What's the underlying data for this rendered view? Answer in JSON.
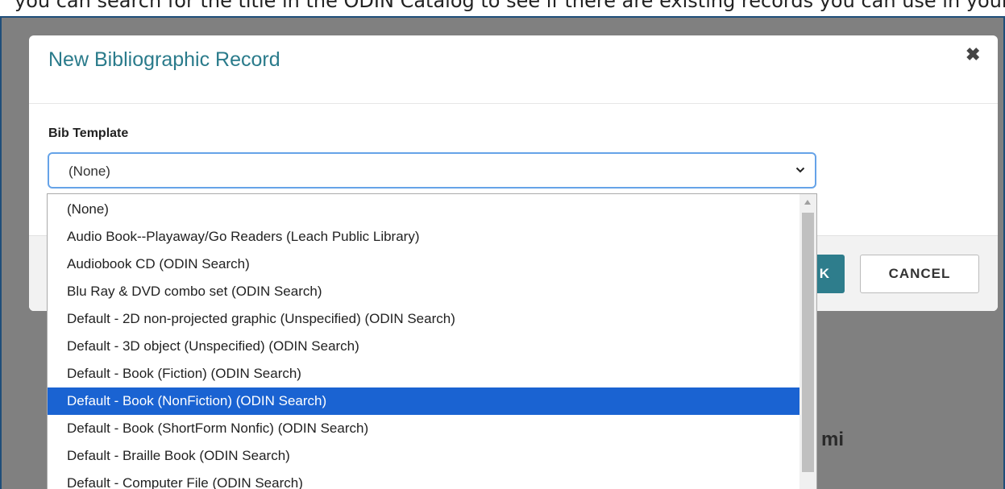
{
  "top_text": "you can search for the title in the ODIN Catalog to see if there are existing records you can use in your catalog.",
  "background_text": "mi",
  "modal": {
    "title": "New Bibliographic Record",
    "close_icon": "close-icon",
    "field_label": "Bib Template",
    "selected_value": "(None)",
    "ok_label": "K",
    "cancel_label": "CANCEL"
  },
  "dropdown": {
    "options": [
      "(None)",
      "Audio Book--Playaway/Go Readers (Leach Public Library)",
      "Audiobook CD (ODIN Search)",
      "Blu Ray & DVD combo set (ODIN Search)",
      "Default - 2D non-projected graphic (Unspecified) (ODIN Search)",
      "Default - 3D object (Unspecified) (ODIN Search)",
      "Default - Book (Fiction) (ODIN Search)",
      "Default - Book (NonFiction) (ODIN Search)",
      "Default - Book (ShortForm Nonfic) (ODIN Search)",
      "Default - Braille Book (ODIN Search)",
      "Default - Computer File (ODIN Search)"
    ],
    "highlighted": "Default - Book (NonFiction) (ODIN Search)"
  },
  "colors": {
    "title": "#2a7b8b",
    "highlight": "#1a63d2",
    "primary_button": "#2e7d8c",
    "focus_border": "#66a3e8",
    "backdrop": "#808080"
  }
}
